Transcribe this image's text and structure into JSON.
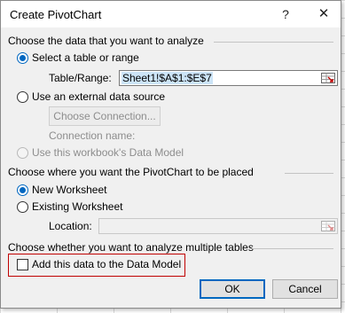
{
  "dialog": {
    "title": "Create PivotChart",
    "help_icon": "?",
    "close_icon": "✕"
  },
  "section1": {
    "title": "Choose the data that you want to analyze",
    "option_table": "Select a table or range",
    "table_range_label": "Table/Range:",
    "table_range_value": "Sheet1!$A$1:$E$7",
    "option_external": "Use an external data source",
    "choose_connection_button": "Choose Connection...",
    "connection_name_label": "Connection name:",
    "option_data_model": "Use this workbook's Data Model"
  },
  "section2": {
    "title": "Choose where you want the PivotChart to be placed",
    "option_new": "New Worksheet",
    "option_existing": "Existing Worksheet",
    "location_label": "Location:",
    "location_value": ""
  },
  "section3": {
    "title": "Choose whether you want to analyze multiple tables",
    "add_to_model_label": "Add this data to the Data Model"
  },
  "footer": {
    "ok_label": "OK",
    "cancel_label": "Cancel"
  },
  "colors": {
    "accent": "#0067c0",
    "highlight_border": "#c00000"
  }
}
